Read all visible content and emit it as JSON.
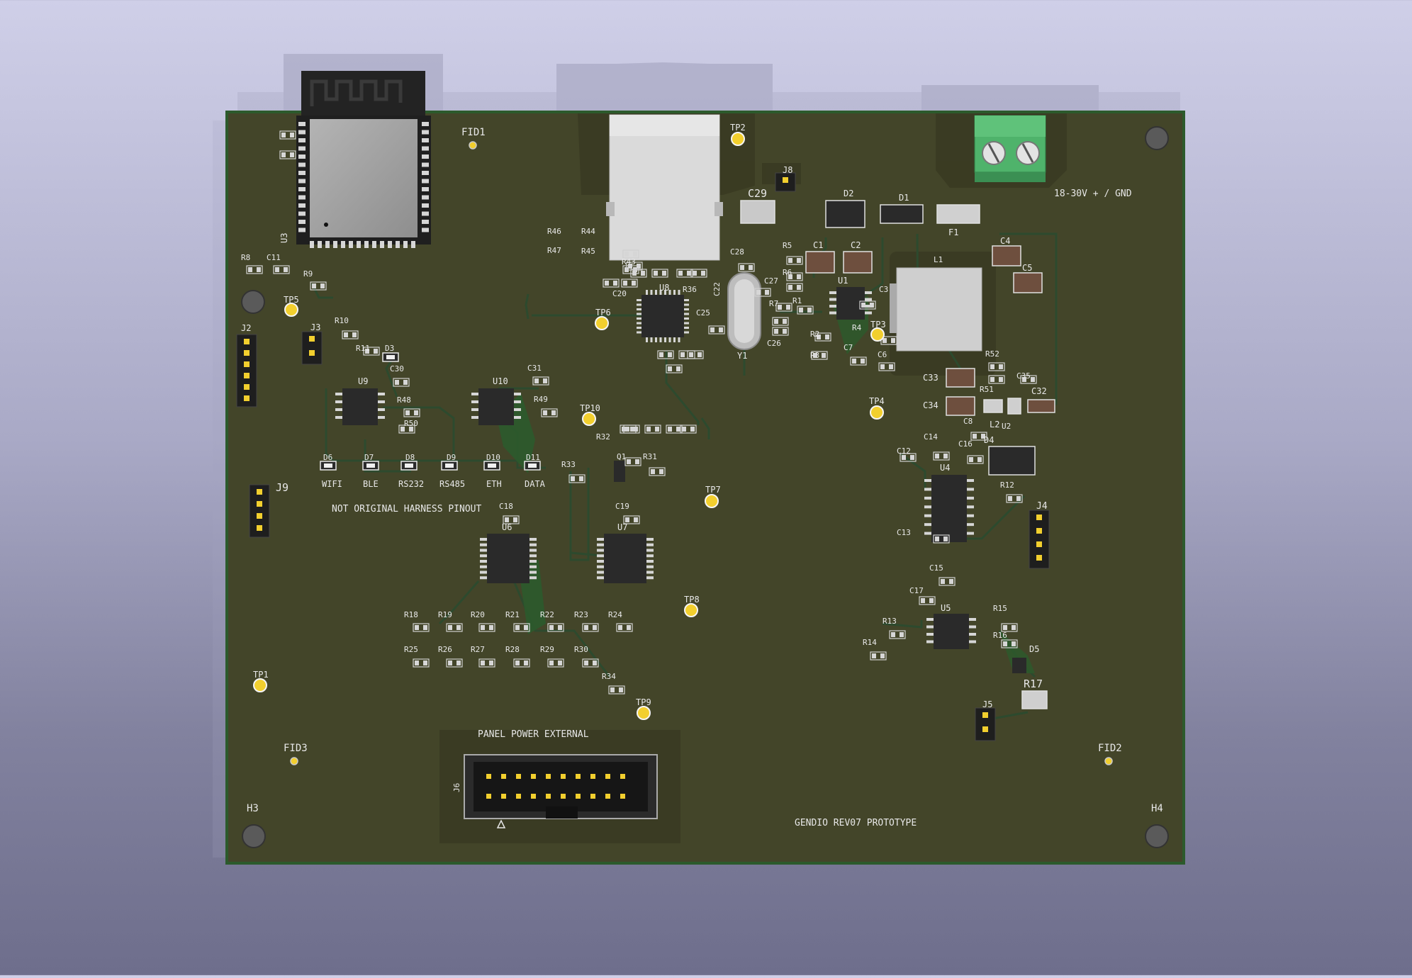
{
  "board": {
    "colors": {
      "substrate": "#434529",
      "substrate_edge": "#2f3a23",
      "trace": "#2d4a2e",
      "silk": "#e8e8e8",
      "pad": "#d6d6d6",
      "gold": "#f2cf2e",
      "ic": "#2a2a2a",
      "terminal_green": "#4fb36b",
      "background_top": "#cfcfe8",
      "background_bottom": "#6e6e8c"
    },
    "labels": {
      "power": "18-30V + / GND",
      "harness": "NOT ORIGINAL HARNESS PINOUT",
      "panel": "PANEL POWER EXTERNAL",
      "revision": "GENDIO REV07 PROTOTYPE",
      "led_wifi": "WIFI",
      "led_ble": "BLE",
      "led_rs232": "RS232",
      "led_rs485": "RS485",
      "led_eth": "ETH",
      "led_data": "DATA"
    },
    "refs": {
      "U1": "U1",
      "U2": "U2",
      "U3": "U3",
      "U4": "U4",
      "U5": "U5",
      "U6": "U6",
      "U7": "U7",
      "U8": "U8",
      "U9": "U9",
      "U10": "U10",
      "J2": "J2",
      "J3": "J3",
      "J4": "J4",
      "J5": "J5",
      "J6": "J6",
      "J8": "J8",
      "J9": "J9",
      "L1": "L1",
      "L2": "L2",
      "Y1": "Y1",
      "Q1": "Q1",
      "F1": "F1",
      "D1": "D1",
      "D2": "D2",
      "D3": "D3",
      "D4": "D4",
      "D5": "D5",
      "D6": "D6",
      "D7": "D7",
      "D8": "D8",
      "D9": "D9",
      "D10": "D10",
      "D11": "D11",
      "C1": "C1",
      "C2": "C2",
      "C3": "C3",
      "C4": "C4",
      "C5": "C5",
      "C6": "C6",
      "C7": "C7",
      "C8": "C8",
      "C11": "C11",
      "C12": "C12",
      "C13": "C13",
      "C14": "C14",
      "C15": "C15",
      "C16": "C16",
      "C17": "C17",
      "C18": "C18",
      "C19": "C19",
      "C20": "C20",
      "C22": "C22",
      "C25": "C25",
      "C26": "C26",
      "C27": "C27",
      "C28": "C28",
      "C29": "C29",
      "C30": "C30",
      "C31": "C31",
      "C32": "C32",
      "C33": "C33",
      "C34": "C34",
      "C35": "C35",
      "R1": "R1",
      "R2": "R2",
      "R3": "R3",
      "R4": "R4",
      "R5": "R5",
      "R6": "R6",
      "R7": "R7",
      "R8": "R8",
      "R9": "R9",
      "R10": "R10",
      "R11": "R11",
      "R12": "R12",
      "R13": "R13",
      "R14": "R14",
      "R15": "R15",
      "R16": "R16",
      "R17": "R17",
      "R18": "R18",
      "R19": "R19",
      "R20": "R20",
      "R21": "R21",
      "R22": "R22",
      "R23": "R23",
      "R24": "R24",
      "R25": "R25",
      "R26": "R26",
      "R27": "R27",
      "R28": "R28",
      "R29": "R29",
      "R30": "R30",
      "R31": "R31",
      "R32": "R32",
      "R33": "R33",
      "R34": "R34",
      "R36": "R36",
      "R43": "R43",
      "R44": "R44",
      "R45": "R45",
      "R46": "R46",
      "R47": "R47",
      "R48": "R48",
      "R49": "R49",
      "R50": "R50",
      "R51": "R51",
      "R52": "R52",
      "TP1": "TP1",
      "TP2": "TP2",
      "TP3": "TP3",
      "TP4": "TP4",
      "TP5": "TP5",
      "TP6": "TP6",
      "TP7": "TP7",
      "TP8": "TP8",
      "TP9": "TP9",
      "TP10": "TP10",
      "FID1": "FID1",
      "FID2": "FID2",
      "FID3": "FID3",
      "H3": "H3",
      "H4": "H4"
    }
  }
}
